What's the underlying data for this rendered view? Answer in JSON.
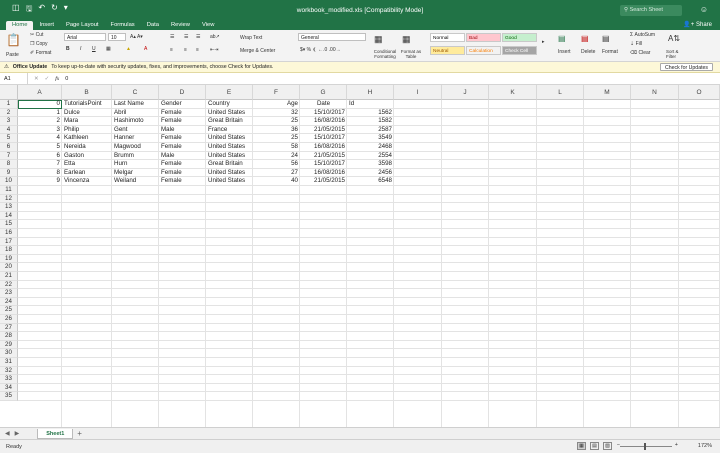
{
  "window": {
    "title": "workbook_modified.xls [Compatibility Mode]",
    "search_placeholder": "Search Sheet",
    "share": "Share"
  },
  "tabs": [
    "Home",
    "Insert",
    "Page Layout",
    "Formulas",
    "Data",
    "Review",
    "View"
  ],
  "ribbon": {
    "paste": "Paste",
    "cut": "Cut",
    "copy": "Copy",
    "format": "Format",
    "font_name": "Arial",
    "font_size": "10",
    "wrap_text": "Wrap Text",
    "merge_center": "Merge & Center",
    "number_format": "General",
    "conditional_formatting": "Conditional Formatting",
    "format_as_table": "Format as Table",
    "styles": [
      {
        "label": "Normal",
        "bg": "#ffffff",
        "color": "#000000"
      },
      {
        "label": "Bad",
        "bg": "#ffc7ce",
        "color": "#9c0006"
      },
      {
        "label": "Good",
        "bg": "#c6efce",
        "color": "#006100"
      },
      {
        "label": "Neutral",
        "bg": "#ffeb9c",
        "color": "#9c5700"
      },
      {
        "label": "Calculation",
        "bg": "#f2f2f2",
        "color": "#fa7d00"
      },
      {
        "label": "Check Cell",
        "bg": "#a5a5a5",
        "color": "#ffffff"
      }
    ],
    "insert": "Insert",
    "delete": "Delete",
    "format_cells": "Format",
    "autosum": "AutoSum",
    "fill": "Fill",
    "clear": "Clear",
    "sort_filter": "Sort & Filter"
  },
  "infobar": {
    "label": "Office Update",
    "message": "To keep up-to-date with security updates, fixes, and improvements, choose Check for Updates.",
    "button": "Check for Updates"
  },
  "formula_bar": {
    "name_box": "A1",
    "fx": "fx",
    "value": "0"
  },
  "columns": [
    "A",
    "B",
    "C",
    "D",
    "E",
    "F",
    "G",
    "H",
    "I",
    "J",
    "K",
    "L",
    "M",
    "N",
    "O"
  ],
  "row_count": 35,
  "header_row": [
    "0",
    "TutorialsPoint",
    "Last Name",
    "Gender",
    "Country",
    "Age",
    "Date",
    "Id"
  ],
  "rows": [
    [
      "1",
      "Dulce",
      "Abril",
      "Female",
      "United States",
      "32",
      "15/10/2017",
      "1562"
    ],
    [
      "2",
      "Mara",
      "Hashimoto",
      "Female",
      "Great Britain",
      "25",
      "16/08/2016",
      "1582"
    ],
    [
      "3",
      "Philip",
      "Gent",
      "Male",
      "France",
      "36",
      "21/05/2015",
      "2587"
    ],
    [
      "4",
      "Kathleen",
      "Hanner",
      "Female",
      "United States",
      "25",
      "15/10/2017",
      "3549"
    ],
    [
      "5",
      "Nereida",
      "Magwood",
      "Female",
      "United States",
      "58",
      "16/08/2016",
      "2468"
    ],
    [
      "6",
      "Gaston",
      "Brumm",
      "Male",
      "United States",
      "24",
      "21/05/2015",
      "2554"
    ],
    [
      "7",
      "Etta",
      "Hurn",
      "Female",
      "Great Britain",
      "56",
      "15/10/2017",
      "3598"
    ],
    [
      "8",
      "Earlean",
      "Melgar",
      "Female",
      "United States",
      "27",
      "16/08/2016",
      "2456"
    ],
    [
      "9",
      "Vincenza",
      "Weiland",
      "Female",
      "United States",
      "40",
      "21/05/2015",
      "6548"
    ]
  ],
  "sheet_tabs": [
    "Sheet1"
  ],
  "status": {
    "ready": "Ready",
    "zoom": "172%"
  },
  "colors": {
    "accent": "#217346"
  }
}
